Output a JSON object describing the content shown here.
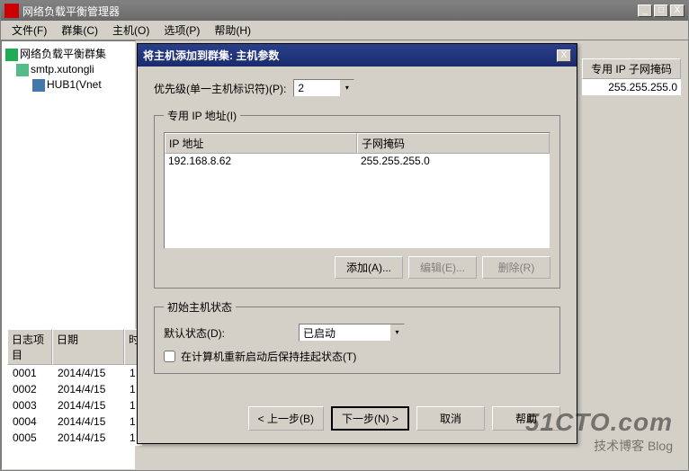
{
  "window": {
    "title": "网络负载平衡管理器",
    "buttons": {
      "min": "_",
      "max": "□",
      "close": "X"
    }
  },
  "menu": {
    "file": "文件(F)",
    "cluster": "群集(C)",
    "host": "主机(O)",
    "options": "选项(P)",
    "help": "帮助(H)"
  },
  "tree": {
    "root": "网络负载平衡群集",
    "node1": "smtp.xutongli",
    "node2": "HUB1(Vnet"
  },
  "right": {
    "col_header": "专用 IP 子网掩码",
    "col_value": "255.255.255.0"
  },
  "log": {
    "headers": {
      "item": "日志项目",
      "date": "日期",
      "time": "时"
    },
    "rows": [
      {
        "id": "0001",
        "date": "2014/4/15",
        "t": "1"
      },
      {
        "id": "0002",
        "date": "2014/4/15",
        "t": "1"
      },
      {
        "id": "0003",
        "date": "2014/4/15",
        "t": "1"
      },
      {
        "id": "0004",
        "date": "2014/4/15",
        "t": "1"
      },
      {
        "id": "0005",
        "date": "2014/4/15",
        "t": "1"
      }
    ]
  },
  "dialog": {
    "title": "将主机添加到群集:   主机参数",
    "close": "X",
    "priority_label": "优先级(单一主机标识符)(P):",
    "priority_value": "2",
    "group_ip": "专用 IP 地址(I)",
    "ip_headers": {
      "ip": "IP 地址",
      "mask": "子网掩码"
    },
    "ip_row": {
      "ip": "192.168.8.62",
      "mask": "255.255.255.0"
    },
    "btn_add": "添加(A)...",
    "btn_edit": "编辑(E)...",
    "btn_del": "删除(R)",
    "group_state": "初始主机状态",
    "state_label": "默认状态(D):",
    "state_value": "已启动",
    "chk_label": "在计算机重新启动后保持挂起状态(T)",
    "wiz_back": "< 上一步(B)",
    "wiz_next": "下一步(N) >",
    "wiz_cancel": "取消",
    "wiz_help": "帮助"
  },
  "watermark": {
    "big": "51CTO.com",
    "small": "技术博客  Blog"
  },
  "glyphs": {
    "down": "▾",
    "left": "◄",
    "right": "►"
  }
}
